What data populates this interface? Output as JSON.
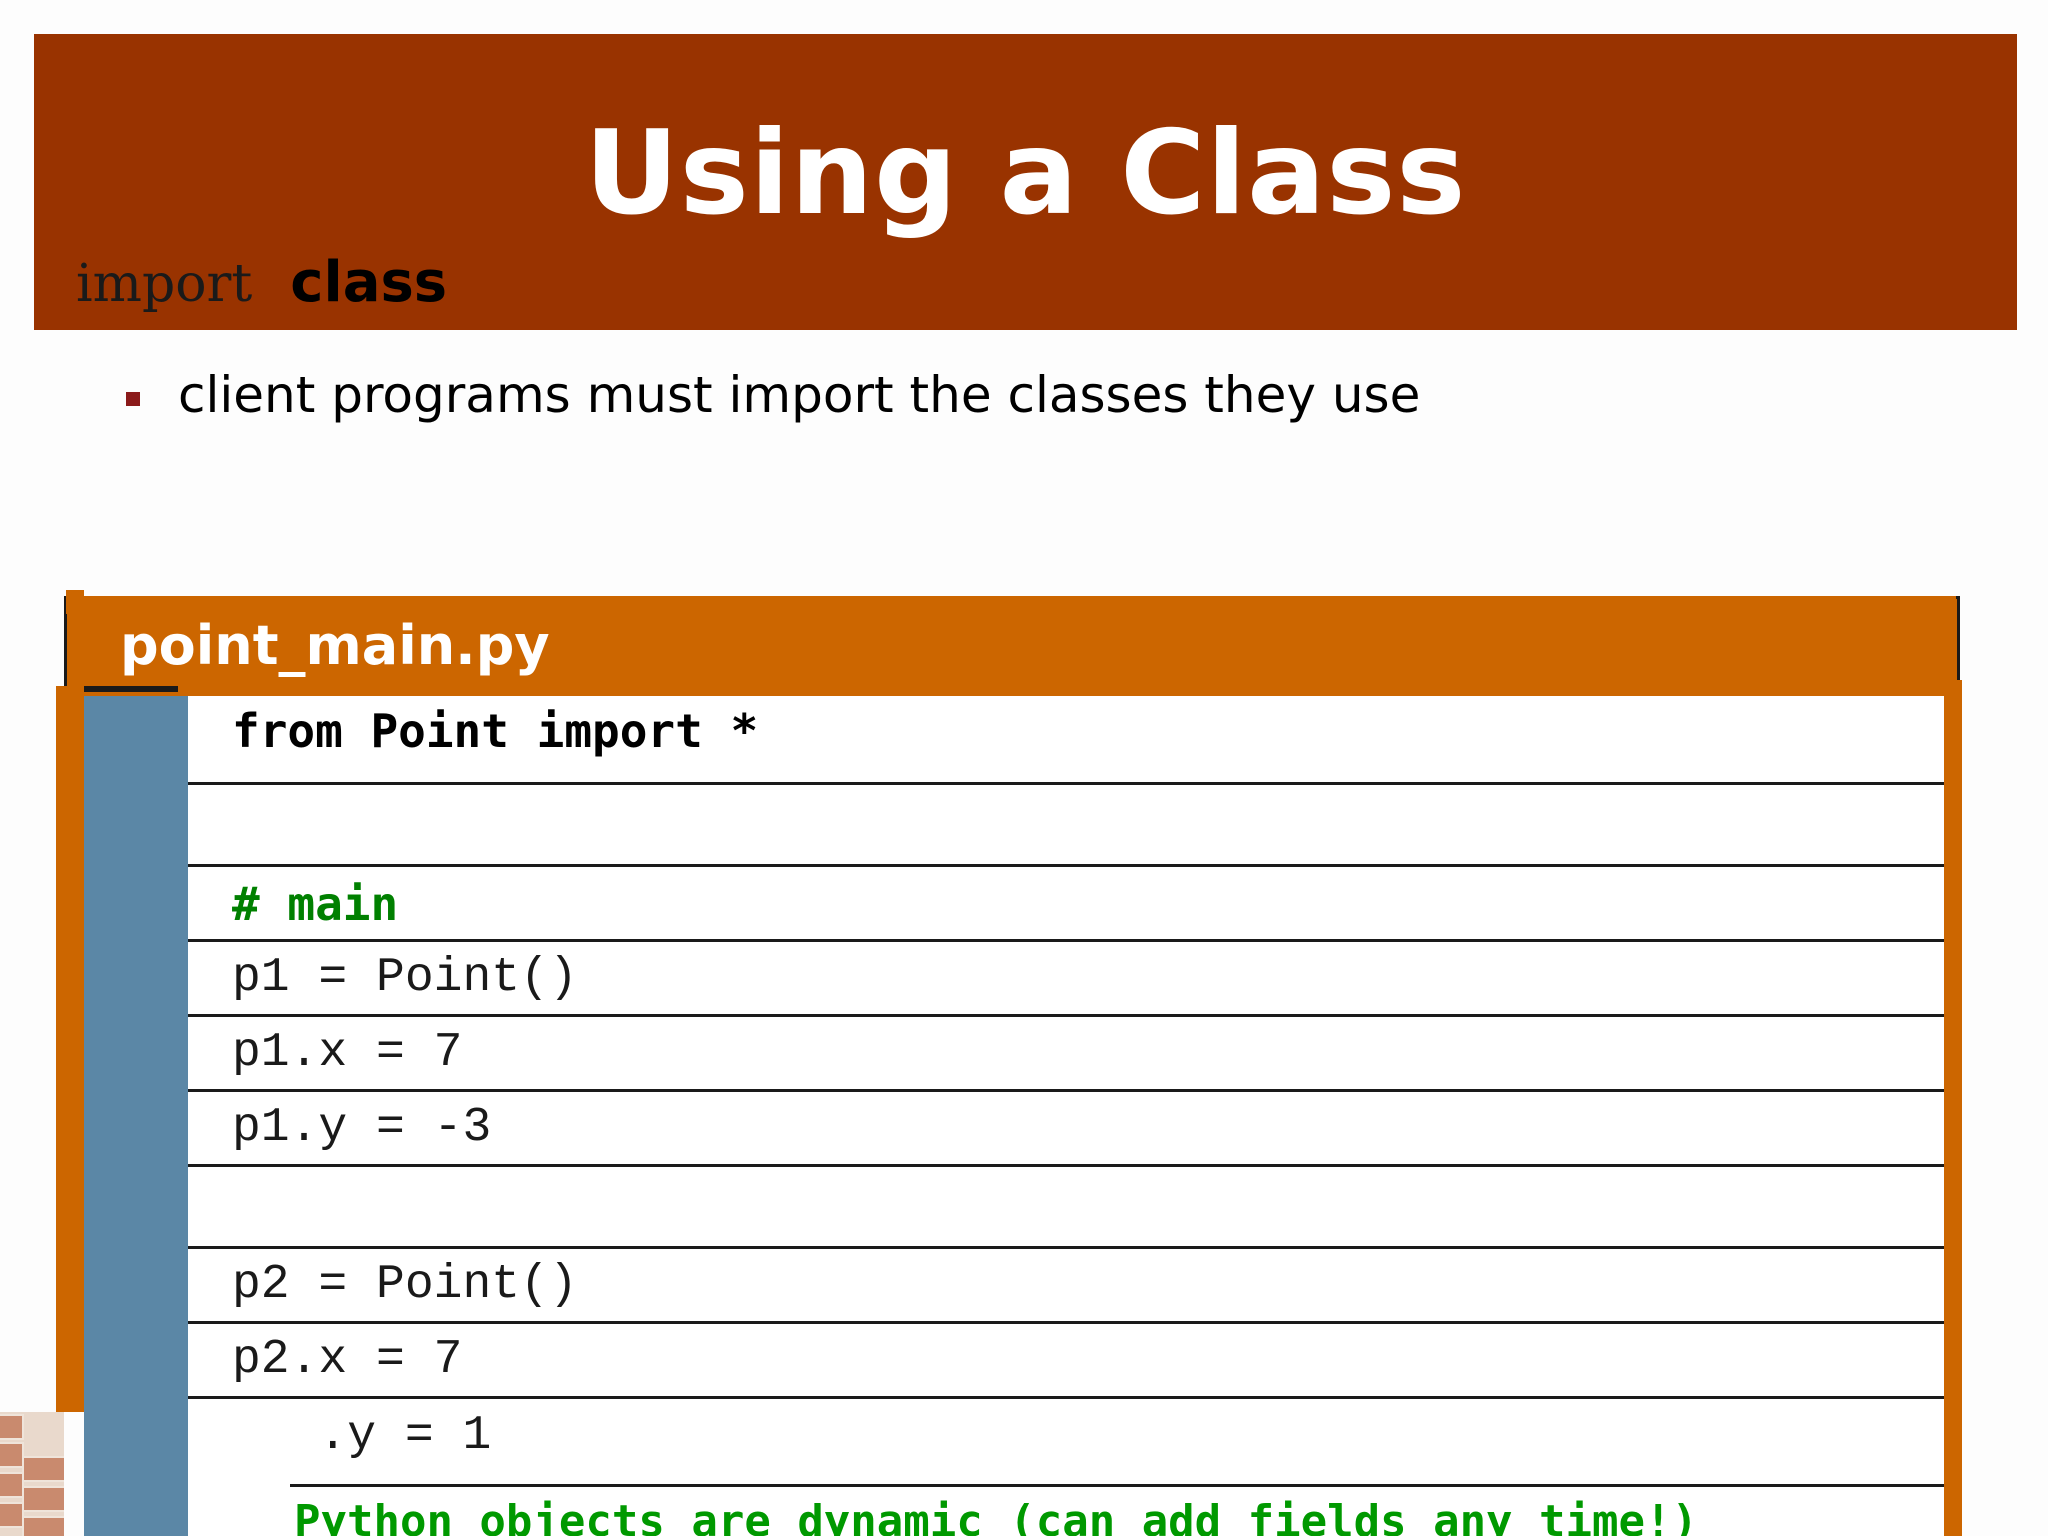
{
  "header": {
    "title": "Using a Class",
    "subtitle_keyword": "import",
    "subtitle_word": "class"
  },
  "bullets": [
    "client programs must import the classes they use"
  ],
  "code_panel": {
    "filename": "point_main.py",
    "lines": [
      "from Point import *",
      "",
      "# main",
      "p1 = Point()",
      "p1.x = 7",
      "p1.y = -3",
      "",
      "p2 = Point()",
      "p2.x = 7",
      "   .y = 1"
    ],
    "note": "Python objects are dynamic (can add fields any time!)"
  },
  "colors": {
    "header_bg": "#993300",
    "panel_orange": "#cc6600",
    "gutter_blue": "#5b87a6",
    "comment_green": "#008000",
    "note_green": "#009900",
    "bullet": "#8b1a1a"
  }
}
